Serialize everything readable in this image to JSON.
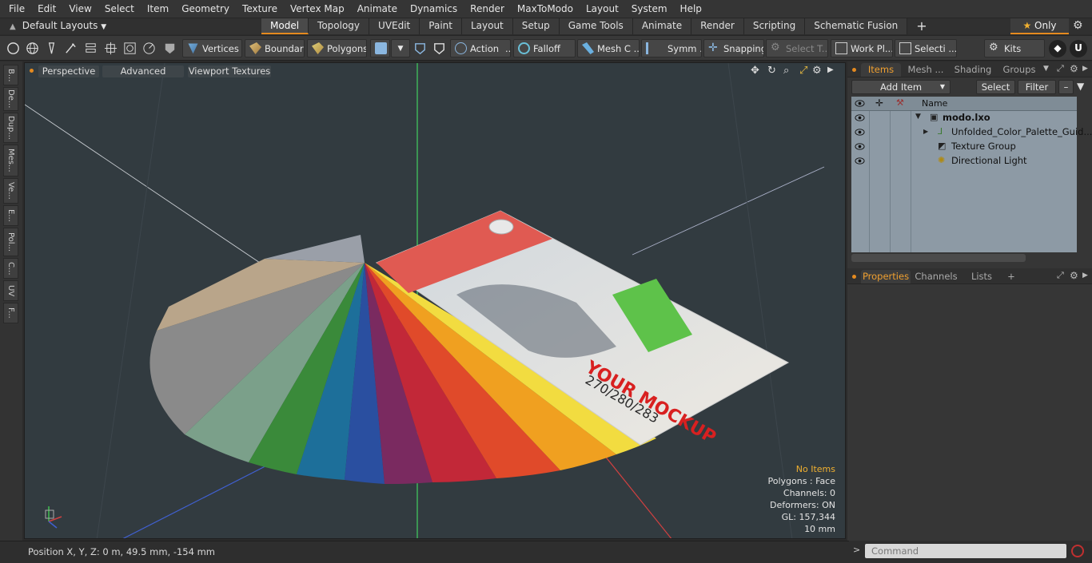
{
  "menu": [
    "File",
    "Edit",
    "View",
    "Select",
    "Item",
    "Geometry",
    "Texture",
    "Vertex Map",
    "Animate",
    "Dynamics",
    "Render",
    "MaxToModo",
    "Layout",
    "System",
    "Help"
  ],
  "layout_selector": "Default Layouts",
  "mode_tabs": [
    "Model",
    "Topology",
    "UVEdit",
    "Paint",
    "Layout",
    "Setup",
    "Game Tools",
    "Animate",
    "Render",
    "Scripting",
    "Schematic Fusion"
  ],
  "active_tab": "Model",
  "only_button": "Only",
  "toolbar": {
    "vertices": "Vertices",
    "boundary": "Boundary",
    "polygons": "Polygons",
    "action": "Action",
    "falloff": "Falloff",
    "mesh_c": "Mesh C ...",
    "symm": "Symm ...",
    "snapping": "Snapping",
    "select_t": "Select T...",
    "work_pl": "Work Pl...",
    "selecti": "Selecti ...",
    "kits": "Kits"
  },
  "left_tabs": [
    "B...",
    "De...",
    "Dup...",
    "Mes...",
    "Ve...",
    "E...",
    "Pol...",
    "C...",
    "UV",
    "F..."
  ],
  "viewport": {
    "view_mode": "Perspective",
    "advanced": "Advanced",
    "textures": "Viewport Textures",
    "card_number": "270/280/283",
    "card_brand": "YOUR MOCKUP",
    "info": {
      "items": "No Items",
      "polygons": "Polygons : Face",
      "channels": "Channels: 0",
      "deformers": "Deformers: ON",
      "gl": "GL: 157,344",
      "scale": "10 mm"
    }
  },
  "status": {
    "position": "Position X, Y, Z:   0 m, 49.5 mm, -154 mm"
  },
  "items_panel": {
    "tabs": [
      "Items",
      "Mesh ...",
      "Shading",
      "Groups"
    ],
    "add_item": "Add Item",
    "select": "Select",
    "filter": "Filter",
    "col_name": "Name",
    "rows": [
      {
        "name": "modo.lxo"
      },
      {
        "name": "Unfolded_Color_Palette_Guid..."
      },
      {
        "name": "Texture Group"
      },
      {
        "name": "Directional Light"
      }
    ]
  },
  "props_panel": {
    "tabs": [
      "Properties",
      "Channels",
      "Lists"
    ]
  },
  "command": {
    "placeholder": "Command"
  },
  "colors": {
    "accent": "#e58a1f",
    "viewport_bg": "#323b40",
    "item_bg": "#8d9aa5"
  }
}
